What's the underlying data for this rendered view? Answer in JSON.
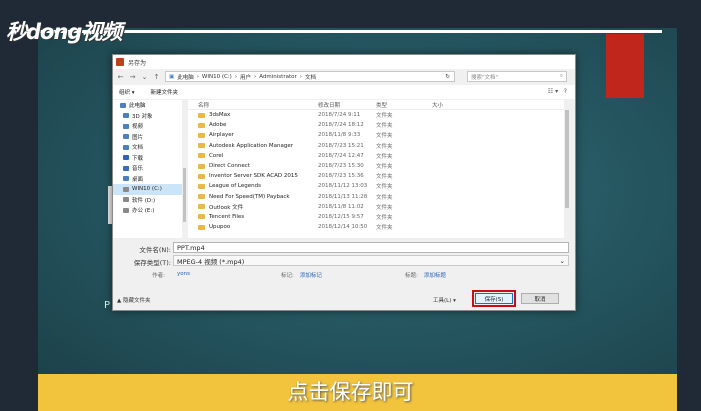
{
  "overlay": {
    "logo": "秒dong视频",
    "caption": "点击保存即可",
    "bg_text": "P   ",
    "colors": {
      "accent": "#c0261b",
      "caption_bar": "#f2c33c",
      "slide_bg": "#2a5e68"
    }
  },
  "dialog": {
    "title": "另存为",
    "nav": {
      "back": "←",
      "forward": "→",
      "up": "↑",
      "refresh": "↻"
    },
    "breadcrumb": [
      "此电脑",
      "WIN10 (C:)",
      "用户",
      "Administrator",
      "文档"
    ],
    "search_placeholder": "搜索\"文档\"",
    "toolbar": {
      "organize": "组织 ▾",
      "new_folder": "新建文件夹"
    },
    "sidebar": [
      {
        "label": "此电脑",
        "icon": "computer-icon"
      },
      {
        "label": "3D 对象",
        "icon": "cube-icon"
      },
      {
        "label": "视频",
        "icon": "video-icon"
      },
      {
        "label": "图片",
        "icon": "image-icon"
      },
      {
        "label": "文档",
        "icon": "document-icon"
      },
      {
        "label": "下载",
        "icon": "download-icon"
      },
      {
        "label": "音乐",
        "icon": "music-icon"
      },
      {
        "label": "桌面",
        "icon": "desktop-icon"
      },
      {
        "label": "WIN10 (C:)",
        "icon": "drive-icon"
      },
      {
        "label": "软件 (D:)",
        "icon": "drive-icon"
      },
      {
        "label": "办公 (E:)",
        "icon": "drive-icon"
      }
    ],
    "columns": {
      "name": "名称",
      "date": "修改日期",
      "type": "类型",
      "size": "大小"
    },
    "files": [
      {
        "name": "3dsMax",
        "date": "2018/7/24 9:11",
        "type": "文件夹"
      },
      {
        "name": "Adobe",
        "date": "2018/7/24 18:12",
        "type": "文件夹"
      },
      {
        "name": "Airplayer",
        "date": "2018/11/8 9:33",
        "type": "文件夹"
      },
      {
        "name": "Autodesk Application Manager",
        "date": "2018/7/23 15:21",
        "type": "文件夹"
      },
      {
        "name": "Corel",
        "date": "2018/7/24 12:47",
        "type": "文件夹"
      },
      {
        "name": "Direct Connect",
        "date": "2018/7/23 15:30",
        "type": "文件夹"
      },
      {
        "name": "Inventor Server SDK ACAD 2015",
        "date": "2018/7/23 15:36",
        "type": "文件夹"
      },
      {
        "name": "League of Legends",
        "date": "2018/11/12 13:03",
        "type": "文件夹"
      },
      {
        "name": "Need For Speed(TM) Payback",
        "date": "2018/11/13 11:28",
        "type": "文件夹"
      },
      {
        "name": "Outlook 文件",
        "date": "2018/11/8 11:02",
        "type": "文件夹"
      },
      {
        "name": "Tencent Files",
        "date": "2018/12/15 9:57",
        "type": "文件夹"
      },
      {
        "name": "Upupoo",
        "date": "2018/12/14 10:50",
        "type": "文件夹"
      }
    ],
    "filename_label": "文件名(N):",
    "filename_value": "PPT.mp4",
    "filetype_label": "保存类型(T):",
    "filetype_value": "MPEG-4 视频 (*.mp4)",
    "authors_label": "作者:",
    "authors_value": "yons",
    "tags_label": "标记:",
    "tags_value": "添加标记",
    "title_label": "标题:",
    "title_value": "添加标题",
    "hide_folders": "▲ 隐藏文件夹",
    "tools": "工具(L)  ▾",
    "save": "保存(S)",
    "cancel": "取消"
  }
}
